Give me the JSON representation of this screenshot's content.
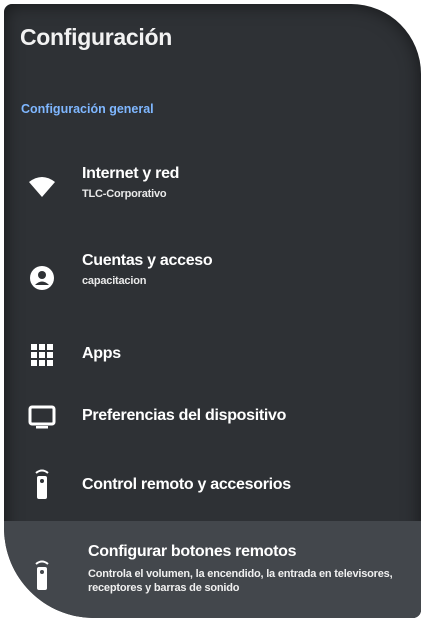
{
  "header": {
    "title": "Configuración"
  },
  "section": {
    "label": "Configuración general"
  },
  "items": [
    {
      "label": "Internet y red",
      "sub": "TLC-Corporativo",
      "icon": "wifi-icon"
    },
    {
      "label": "Cuentas y acceso",
      "sub": "capacitacion",
      "icon": "account-icon"
    },
    {
      "label": "Apps",
      "icon": "apps-grid-icon"
    },
    {
      "label": "Preferencias del dispositivo",
      "icon": "tv-icon"
    },
    {
      "label": "Control remoto y accesorios",
      "icon": "remote-icon"
    },
    {
      "label": "Configurar botones remotos",
      "sub": "Controla el volumen, la encendido, la entrada en televisores, receptores y barras de sonido",
      "icon": "remote-icon"
    }
  ],
  "colors": {
    "background": "#2e3135",
    "accent": "#7fb7ff",
    "selected": "#43474c"
  }
}
